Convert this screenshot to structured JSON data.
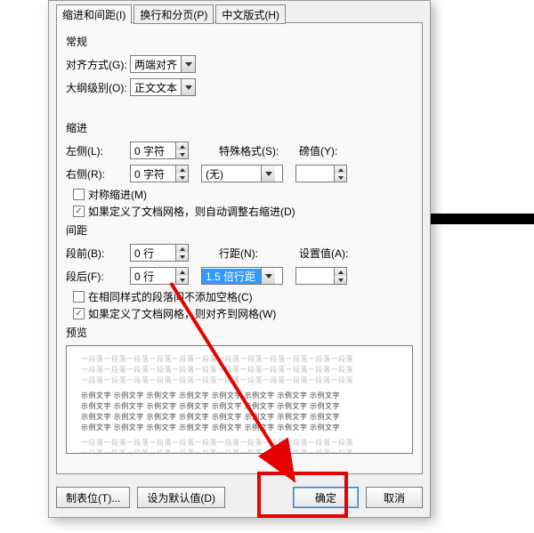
{
  "tabs": {
    "t1": "缩进和间距(I)",
    "t2": "换行和分页(P)",
    "t3": "中文版式(H)"
  },
  "general": {
    "title": "常规",
    "align_label": "对齐方式(G):",
    "align_value": "两端对齐",
    "outline_label": "大纲级别(O):",
    "outline_value": "正文文本"
  },
  "indent": {
    "title": "缩进",
    "left_label": "左侧(L):",
    "left_value": "0 字符",
    "right_label": "右侧(R):",
    "right_value": "0 字符",
    "special_label": "特殊格式(S):",
    "special_value": "(无)",
    "by_label": "磅值(Y):",
    "by_value": "",
    "mirror": "对称缩进(M)",
    "autogrid": "如果定义了文档网格，则自动调整右缩进(D)"
  },
  "spacing": {
    "title": "间距",
    "before_label": "段前(B):",
    "before_value": "0 行",
    "after_label": "段后(F):",
    "after_value": "0 行",
    "line_label": "行距(N):",
    "line_value": "1.5 倍行距",
    "at_label": "设置值(A):",
    "at_value": "",
    "noadd": "在相同样式的段落间不添加空格(C)",
    "snapgrid": "如果定义了文档网格，则对齐到网格(W)"
  },
  "preview": {
    "title": "预览",
    "light": "一段落一段落一段落一段落一段落一段落一段落一段落一段落一段落一段落一段落",
    "dark": "示例文字 示例文字 示例文字 示例文字 示例文字 示例文字 示例文字 示例文字"
  },
  "buttons": {
    "tabs": "制表位(T)...",
    "default": "设为默认值(D)",
    "ok": "确定",
    "cancel": "取消"
  },
  "checks": {
    "mirror": false,
    "autogrid": true,
    "noadd": false,
    "snapgrid": true
  }
}
